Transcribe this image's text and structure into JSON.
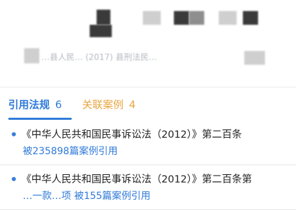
{
  "header": {
    "case_line": "…县人民… (2017) 县刑法民…"
  },
  "tabs": [
    {
      "label": "引用法规",
      "count": "6",
      "active": true
    },
    {
      "label": "关联案例",
      "count": "4",
      "active": false
    }
  ],
  "law_items": [
    {
      "title": "《中华人民共和国民事诉讼法（2012）》第二百条",
      "citation": "被235898篇案例引用"
    },
    {
      "title": "《中华人民共和国民事诉讼法（2012）》第二百条第",
      "citation": "…一款…项 被155篇案例引用"
    }
  ],
  "colors": {
    "active_tab": "#2f7ad9",
    "inactive_tab": "#e8a640",
    "citation_link": "#2f7ad9",
    "bullet": "#3a7fd8"
  }
}
